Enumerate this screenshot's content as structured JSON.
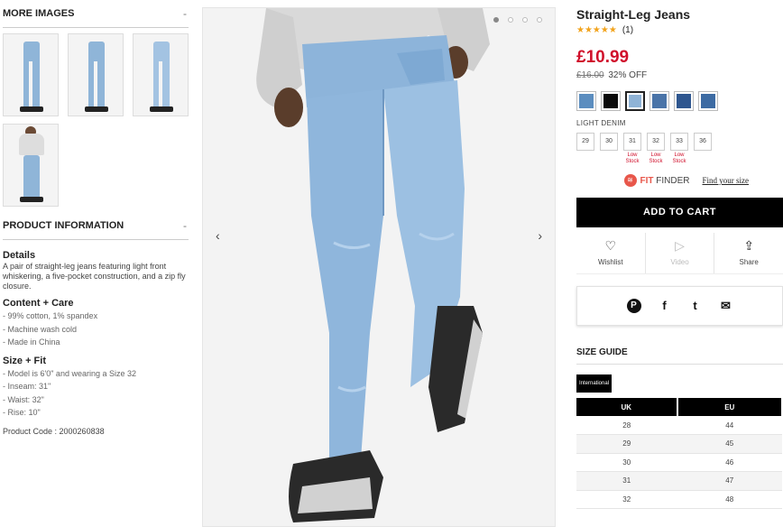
{
  "more_images": {
    "title": "MORE IMAGES",
    "toggle": "-",
    "thumbnails": [
      {
        "icon": "front-jeans-thumb"
      },
      {
        "icon": "side-jeans-thumb"
      },
      {
        "icon": "back-jeans-thumb"
      },
      {
        "icon": "full-body-thumb"
      }
    ]
  },
  "product_info": {
    "title": "PRODUCT INFORMATION",
    "toggle": "-",
    "details_heading": "Details",
    "details_text": "A pair of straight-leg jeans featuring light front whiskering, a five-pocket construction, and a zip fly closure.",
    "content_heading": "Content + Care",
    "content_items": [
      "- 99% cotton, 1% spandex",
      "- Machine wash cold",
      "- Made in China"
    ],
    "size_heading": "Size + Fit",
    "size_items": [
      "- Model is 6'0\" and wearing a Size 32",
      "- Inseam: 31\"",
      "- Waist: 32\"",
      "- Rise: 10\""
    ],
    "product_code": "Product Code : 2000260838"
  },
  "gallery": {
    "prev": "‹",
    "next": "›",
    "dot_count": 4,
    "active_dot": 0
  },
  "product": {
    "title": "Straight-Leg Jeans",
    "stars": "★★★★★",
    "review_count": "(1)",
    "price": "£10.99",
    "was_price": "£16.00",
    "discount": "32% OFF",
    "swatches": [
      {
        "color": "#5b8dbf"
      },
      {
        "color": "#0a0a0a"
      },
      {
        "color": "#8fb3d6"
      },
      {
        "color": "#4a74a8"
      },
      {
        "color": "#2e568f"
      },
      {
        "color": "#3d6ba3"
      }
    ],
    "selected_swatch": 2,
    "color_name": "LIGHT DENIM",
    "sizes": [
      {
        "label": "29",
        "stock": ""
      },
      {
        "label": "30",
        "stock": ""
      },
      {
        "label": "31",
        "stock": "Low Stock"
      },
      {
        "label": "32",
        "stock": "Low Stock"
      },
      {
        "label": "33",
        "stock": "Low Stock"
      },
      {
        "label": "36",
        "stock": ""
      }
    ],
    "fit_finder": "FIT",
    "fit_finder_suffix": " FINDER",
    "find_size": "Find your size",
    "add_to_cart": "ADD TO CART",
    "actions": [
      {
        "label": "Wishlist",
        "icon": "heart-icon",
        "glyph": "♡",
        "enabled": true
      },
      {
        "label": "Video",
        "icon": "play-icon",
        "glyph": "▷",
        "enabled": false
      },
      {
        "label": "Share",
        "icon": "share-icon",
        "glyph": "⇪",
        "enabled": true
      }
    ],
    "social": [
      {
        "icon": "pinterest-icon",
        "glyph": "P"
      },
      {
        "icon": "facebook-icon",
        "glyph": "f"
      },
      {
        "icon": "twitter-icon",
        "glyph": "t"
      },
      {
        "icon": "email-icon",
        "glyph": "✉"
      }
    ]
  },
  "size_guide": {
    "title": "SIZE GUIDE",
    "tab": "International",
    "headers": [
      "UK",
      "EU"
    ],
    "rows": [
      [
        "28",
        "44"
      ],
      [
        "29",
        "45"
      ],
      [
        "30",
        "46"
      ],
      [
        "31",
        "47"
      ],
      [
        "32",
        "48"
      ]
    ]
  },
  "colors": {
    "accent_red": "#d0102b",
    "star": "#f2a31c",
    "fit_finder": "#e8574b"
  }
}
